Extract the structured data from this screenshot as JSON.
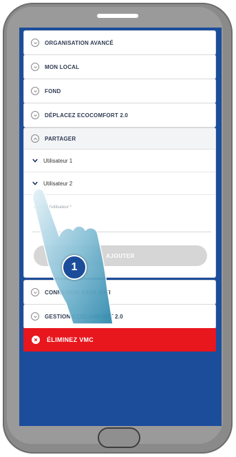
{
  "sections_top": [
    {
      "label": "ORGANISATION AVANCÉ"
    },
    {
      "label": "MON LOCAL"
    },
    {
      "label": "FOND"
    },
    {
      "label": "DÉPLACEZ ECOCOMFORT 2.0"
    }
  ],
  "partager": {
    "title": "PARTAGER",
    "users": [
      {
        "label": "Utilisateur 1"
      },
      {
        "label": "Utilisateur 2"
      }
    ],
    "email_label": "Nom de l'utilisateur *",
    "email_value": "",
    "add_label": "AJOUTER"
  },
  "sections_bottom": [
    {
      "label": "CONNEXION SANS WIFI"
    },
    {
      "label": "GESTION ECOCOMFORT 2.0"
    }
  ],
  "remove": {
    "label": "ÉLIMINEZ VMC"
  },
  "step": {
    "number": "1"
  },
  "colors": {
    "screen_bg": "#1b4d9b",
    "danger": "#e8161d",
    "button_disabled": "#d6d6d6"
  }
}
